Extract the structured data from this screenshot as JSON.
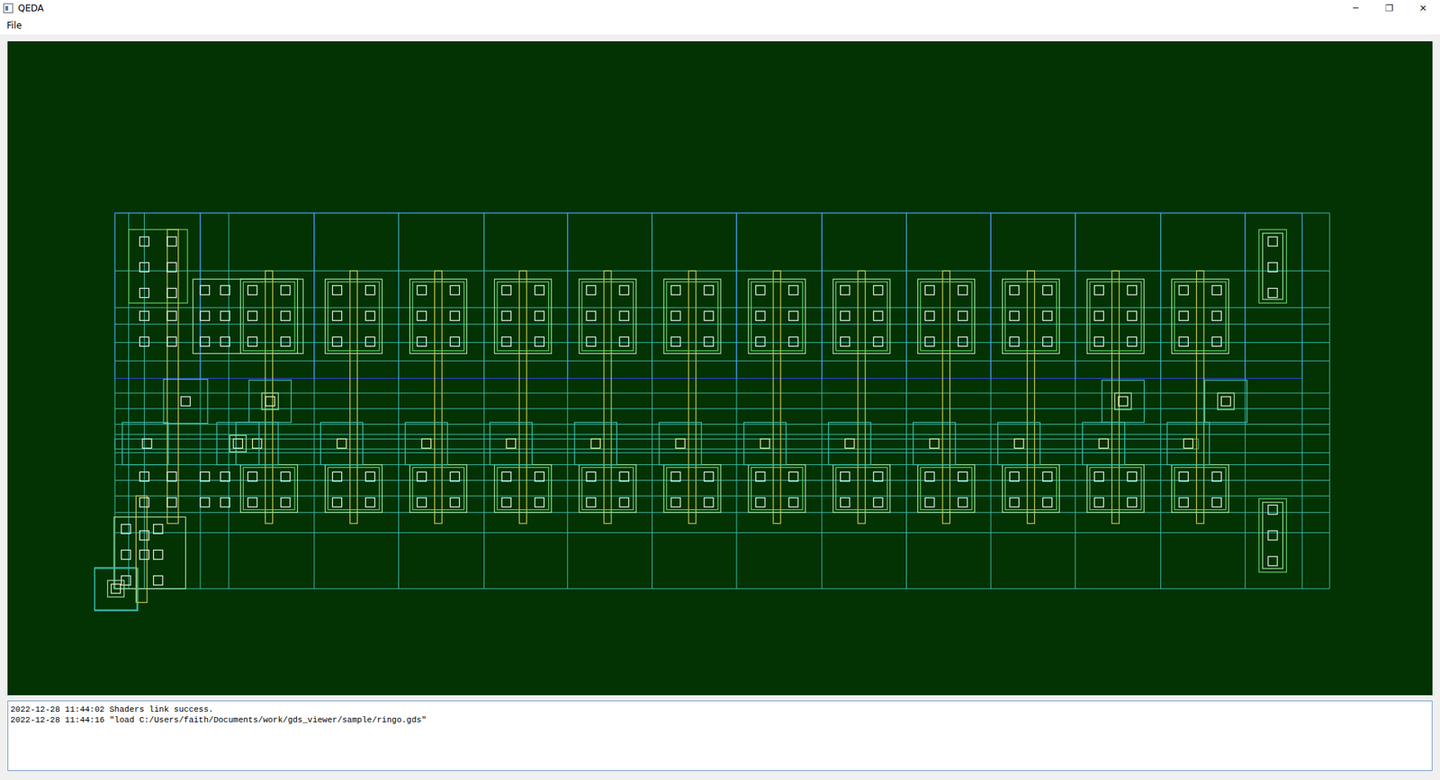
{
  "window": {
    "title": "QEDA",
    "controls": [
      "─",
      "❐",
      "✕"
    ]
  },
  "menu": [
    {
      "label": "File"
    }
  ],
  "log": [
    "2022-12-28 11:44:02 Shaders link success.",
    "2022-12-28 11:44:16 \"load C:/Users/faith/Documents/work/gds_viewer/sample/ringo.gds\""
  ]
}
